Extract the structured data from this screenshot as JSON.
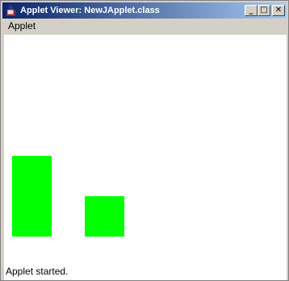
{
  "window": {
    "title": "Applet Viewer: NewJApplet.class",
    "titlebar_color": "#0a246a",
    "controls": {
      "minimize": "_",
      "maximize": "□",
      "close": "✕"
    }
  },
  "menubar": {
    "items": [
      {
        "label": "Applet"
      }
    ]
  },
  "applet": {
    "background": "#ffffff",
    "shape_color": "#00ff00",
    "shapes": [
      {
        "kind": "rectangle"
      },
      {
        "kind": "rectangle"
      }
    ]
  },
  "status": {
    "text": "Applet started."
  }
}
